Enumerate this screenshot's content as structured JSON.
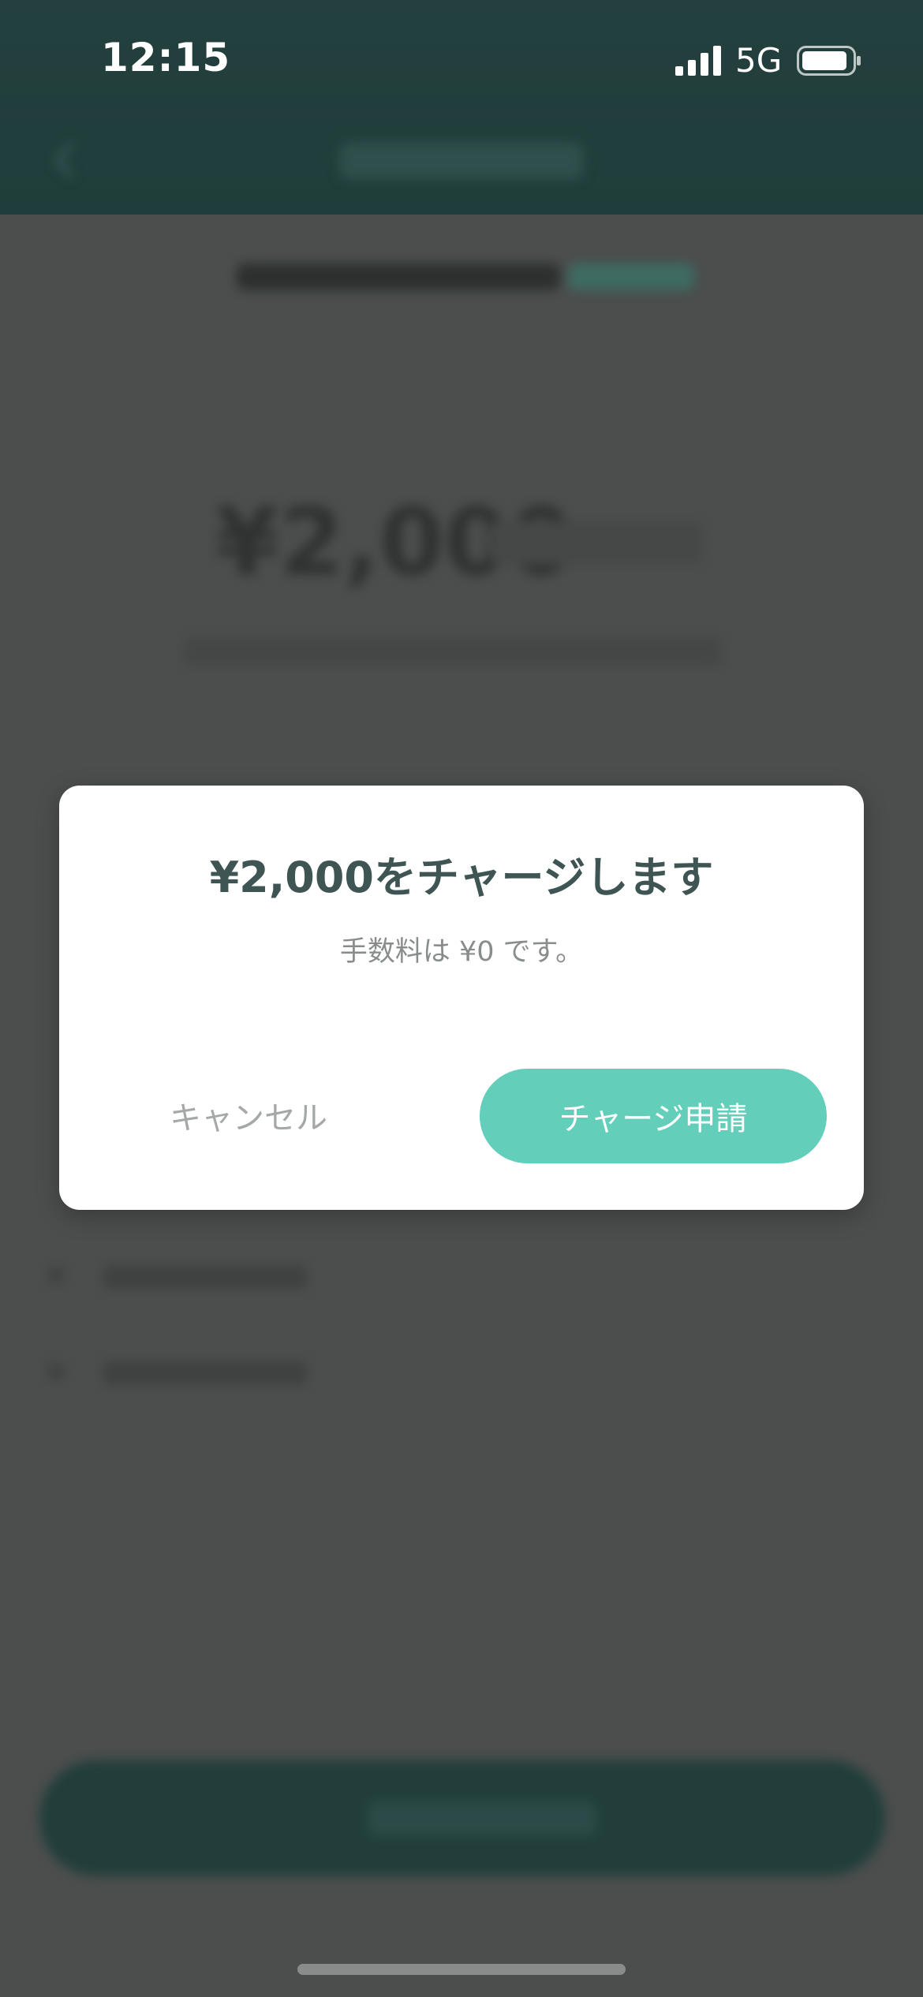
{
  "status_bar": {
    "time": "12:15",
    "network": "5G",
    "icons": [
      "signal-icon",
      "battery-icon"
    ]
  },
  "background": {
    "amount": "¥2,000"
  },
  "dialog": {
    "title": "¥2,000をチャージします",
    "message": "手数料は ¥0 です。",
    "cancel_label": "キャンセル",
    "confirm_label": "チャージ申請"
  },
  "colors": {
    "accent": "#63ceb9",
    "header": "#1f3d3a",
    "dialog_title": "#3f5553"
  }
}
